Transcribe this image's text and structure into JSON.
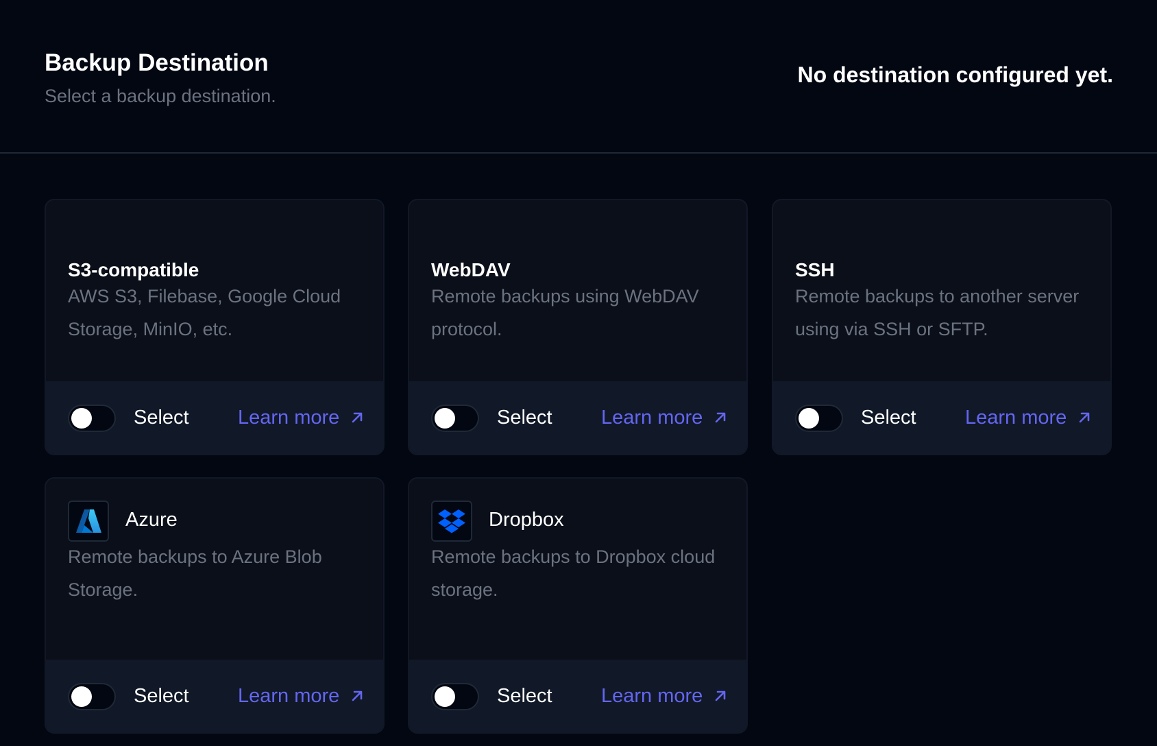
{
  "header": {
    "title": "Backup Destination",
    "subtitle": "Select a backup destination.",
    "status": "No destination configured yet."
  },
  "colors": {
    "background": "#030712",
    "card": "#0b0f19",
    "card_footer": "#111827",
    "accent": "#6366f1",
    "muted_text": "#6b7280",
    "azure_blue": "#0078d4",
    "dropbox_blue": "#0061fe"
  },
  "cards": [
    {
      "title": "S3-compatible",
      "description": "AWS S3, Filebase, Google Cloud Storage, MinIO, etc.",
      "select_label": "Select",
      "learn_more_label": "Learn more",
      "selected": false
    },
    {
      "title": "WebDAV",
      "description": "Remote backups using WebDAV protocol.",
      "select_label": "Select",
      "learn_more_label": "Learn more",
      "selected": false
    },
    {
      "title": "SSH",
      "description": "Remote backups to another server using via SSH or SFTP.",
      "select_label": "Select",
      "learn_more_label": "Learn more",
      "selected": false
    },
    {
      "title": "Azure",
      "icon": "azure-logo-icon",
      "description": "Remote backups to Azure Blob Storage.",
      "select_label": "Select",
      "learn_more_label": "Learn more",
      "selected": false
    },
    {
      "title": "Dropbox",
      "icon": "dropbox-logo-icon",
      "description": "Remote backups to Dropbox cloud storage.",
      "select_label": "Select",
      "learn_more_label": "Learn more",
      "selected": false
    }
  ],
  "icons": {
    "external_link": "arrow-up-right-icon"
  }
}
